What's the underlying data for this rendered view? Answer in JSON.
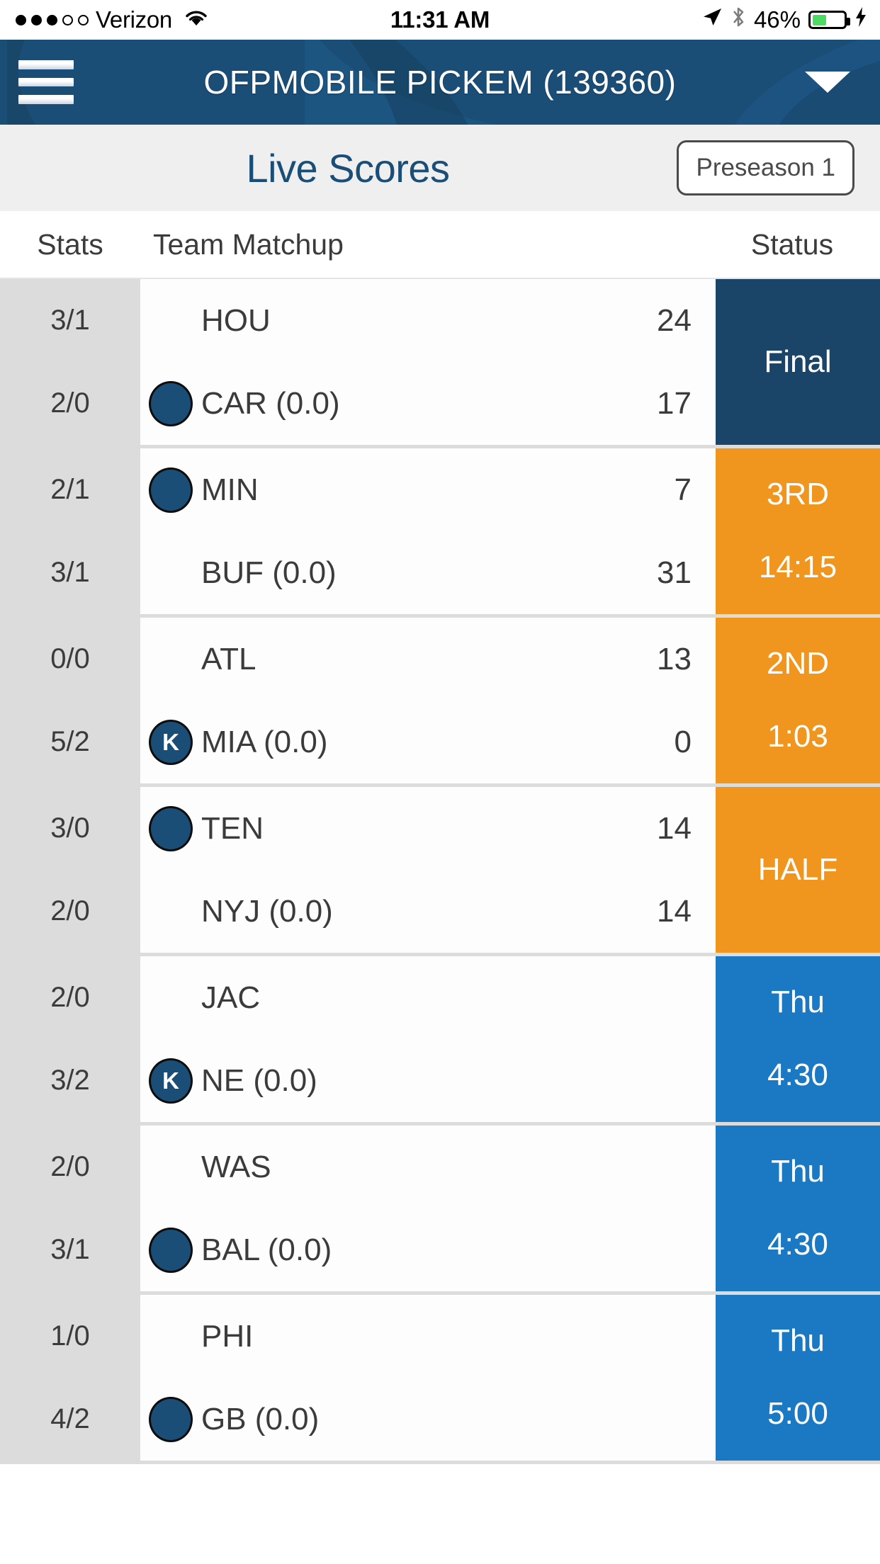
{
  "statusbar": {
    "carrier": "Verizon",
    "signal_dots_filled": 3,
    "signal_dots_total": 5,
    "wifi_icon": "wifi-icon",
    "time": "11:31 AM",
    "location_icon": "location-arrow-icon",
    "bluetooth_icon": "bluetooth-icon",
    "battery_percent": "46%",
    "battery_level": 46,
    "charging": true,
    "battery_color": "#4CD964"
  },
  "appbar": {
    "menu_icon": "hamburger-menu-icon",
    "title": "OFPMOBILE PICKEM  (139360)",
    "dropdown_icon": "caret-down-icon",
    "background_color": "#1B4E77"
  },
  "titleband": {
    "page_title": "Live Scores",
    "title_color": "#1B4E77",
    "week_selector": "Preseason 1",
    "background_color": "#EFEFEF"
  },
  "columns": {
    "stats": "Stats",
    "matchup": "Team Matchup",
    "status": "Status"
  },
  "status_colors": {
    "final": "#1A4569",
    "live": "#F0951E",
    "upcoming": "#1B78C2"
  },
  "games": [
    {
      "away": {
        "stats": "3/1",
        "name": "HOU",
        "score": "24",
        "marker": "none"
      },
      "home": {
        "stats": "2/0",
        "name": "CAR (0.0)",
        "score": "17",
        "marker": "dot"
      },
      "status": {
        "line1": "Final",
        "line2": "",
        "state": "final"
      }
    },
    {
      "away": {
        "stats": "2/1",
        "name": "MIN",
        "score": "7",
        "marker": "dot"
      },
      "home": {
        "stats": "3/1",
        "name": "BUF (0.0)",
        "score": "31",
        "marker": "none"
      },
      "status": {
        "line1": "3RD",
        "line2": "14:15",
        "state": "live"
      }
    },
    {
      "away": {
        "stats": "0/0",
        "name": "ATL",
        "score": "13",
        "marker": "none"
      },
      "home": {
        "stats": "5/2",
        "name": "MIA (0.0)",
        "score": "0",
        "marker": "K"
      },
      "status": {
        "line1": "2ND",
        "line2": "1:03",
        "state": "live"
      }
    },
    {
      "away": {
        "stats": "3/0",
        "name": "TEN",
        "score": "14",
        "marker": "dot"
      },
      "home": {
        "stats": "2/0",
        "name": "NYJ (0.0)",
        "score": "14",
        "marker": "none"
      },
      "status": {
        "line1": "HALF",
        "line2": "",
        "state": "live"
      }
    },
    {
      "away": {
        "stats": "2/0",
        "name": "JAC",
        "score": "",
        "marker": "none"
      },
      "home": {
        "stats": "3/2",
        "name": "NE (0.0)",
        "score": "",
        "marker": "K"
      },
      "status": {
        "line1": "Thu",
        "line2": "4:30",
        "state": "upcoming"
      }
    },
    {
      "away": {
        "stats": "2/0",
        "name": "WAS",
        "score": "",
        "marker": "none"
      },
      "home": {
        "stats": "3/1",
        "name": "BAL (0.0)",
        "score": "",
        "marker": "dot"
      },
      "status": {
        "line1": "Thu",
        "line2": "4:30",
        "state": "upcoming"
      }
    },
    {
      "away": {
        "stats": "1/0",
        "name": "PHI",
        "score": "",
        "marker": "none"
      },
      "home": {
        "stats": "4/2",
        "name": "GB (0.0)",
        "score": "",
        "marker": "dot"
      },
      "status": {
        "line1": "Thu",
        "line2": "5:00",
        "state": "upcoming"
      }
    }
  ]
}
